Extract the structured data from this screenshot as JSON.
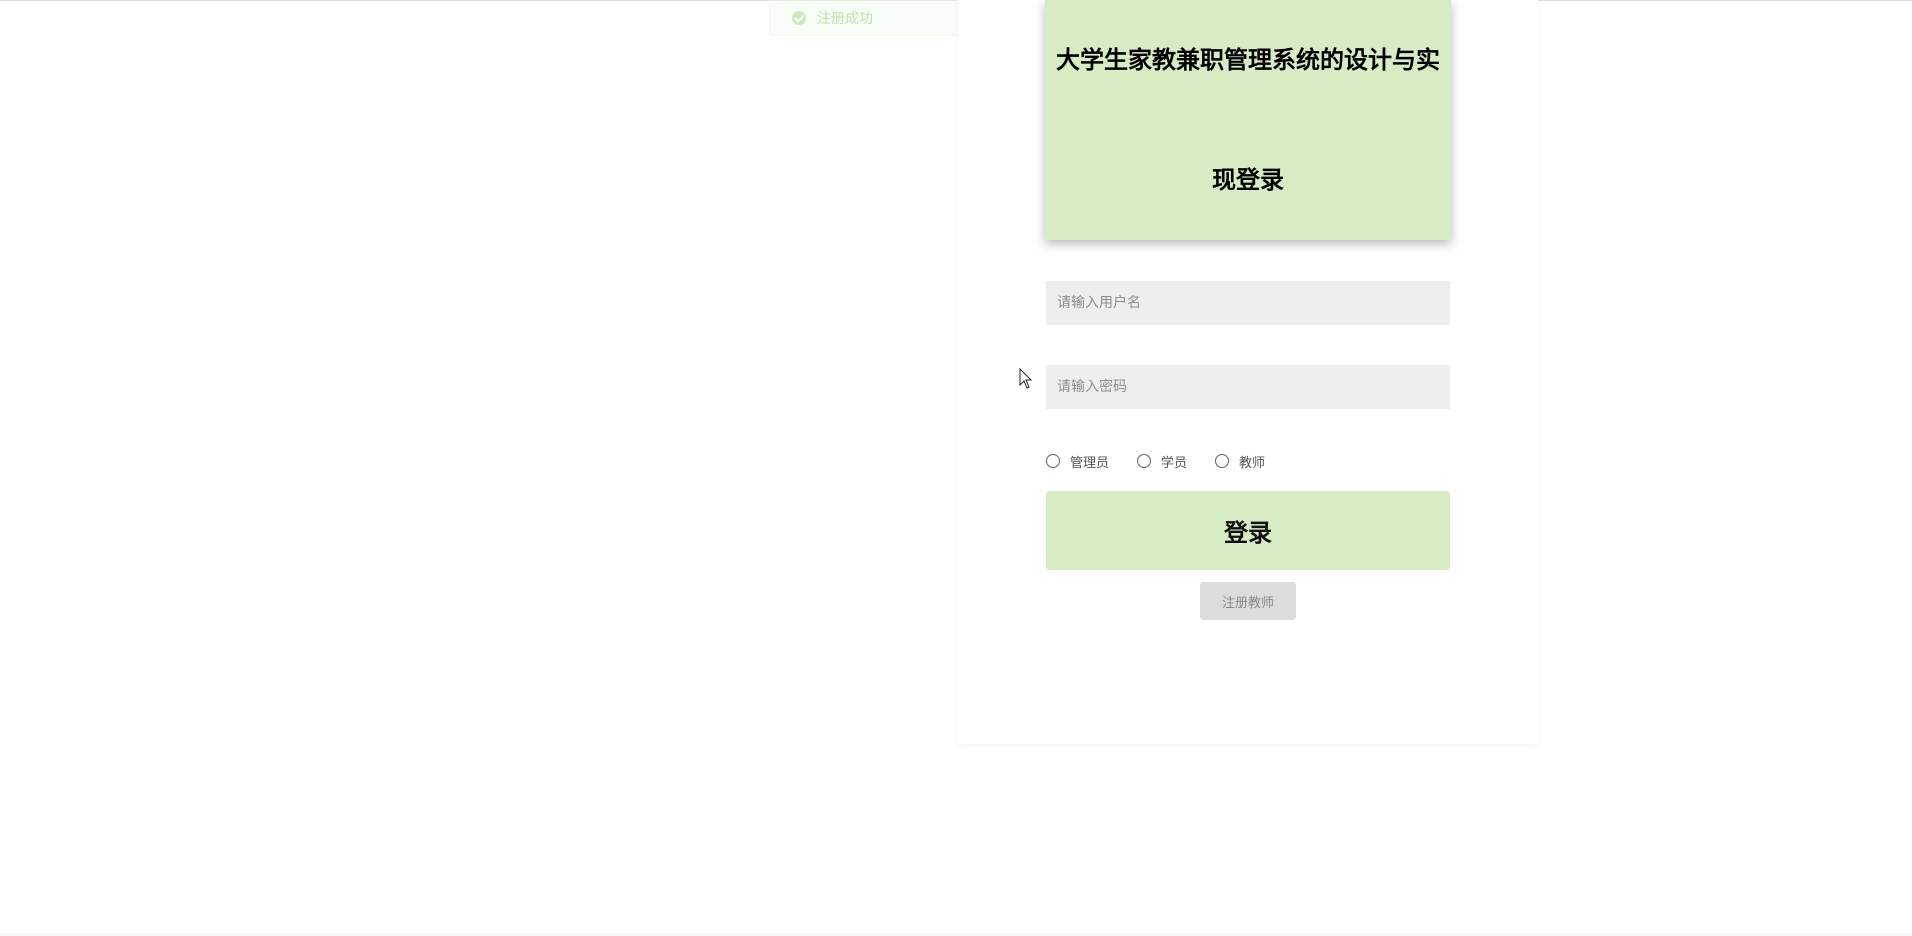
{
  "toast": {
    "message": "注册成功"
  },
  "header": {
    "title": "大学生家教兼职管理系统的设计与实现登录"
  },
  "form": {
    "username_placeholder": "请输入用户名",
    "password_placeholder": "请输入密码",
    "roles": [
      "管理员",
      "学员",
      "教师"
    ],
    "login_label": "登录",
    "register_label": "注册教师"
  },
  "colors": {
    "accent": "#d7ecc5",
    "input_bg": "#eeeeee",
    "toast_text": "#a6d88e"
  }
}
